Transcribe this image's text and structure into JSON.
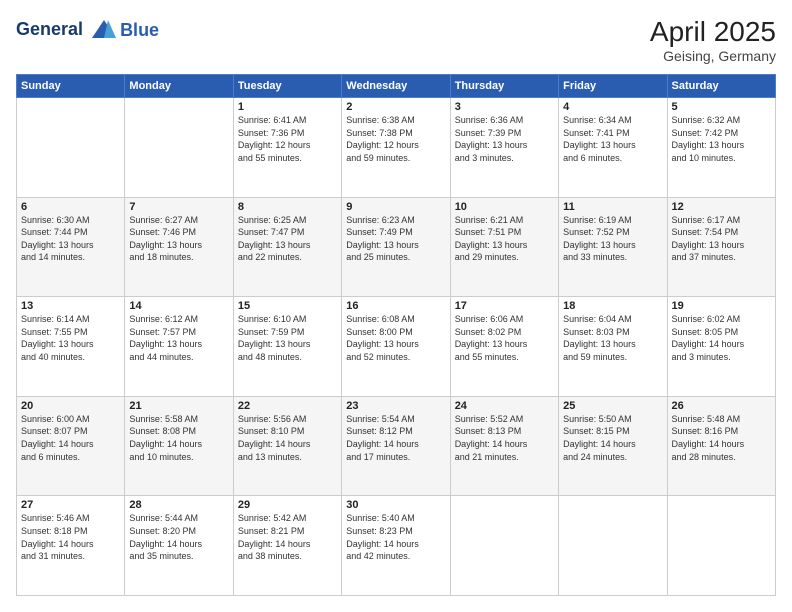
{
  "header": {
    "logo_line1": "General",
    "logo_line2": "Blue",
    "month_year": "April 2025",
    "location": "Geising, Germany"
  },
  "weekdays": [
    "Sunday",
    "Monday",
    "Tuesday",
    "Wednesday",
    "Thursday",
    "Friday",
    "Saturday"
  ],
  "weeks": [
    [
      {
        "day": "",
        "info": ""
      },
      {
        "day": "",
        "info": ""
      },
      {
        "day": "1",
        "info": "Sunrise: 6:41 AM\nSunset: 7:36 PM\nDaylight: 12 hours\nand 55 minutes."
      },
      {
        "day": "2",
        "info": "Sunrise: 6:38 AM\nSunset: 7:38 PM\nDaylight: 12 hours\nand 59 minutes."
      },
      {
        "day": "3",
        "info": "Sunrise: 6:36 AM\nSunset: 7:39 PM\nDaylight: 13 hours\nand 3 minutes."
      },
      {
        "day": "4",
        "info": "Sunrise: 6:34 AM\nSunset: 7:41 PM\nDaylight: 13 hours\nand 6 minutes."
      },
      {
        "day": "5",
        "info": "Sunrise: 6:32 AM\nSunset: 7:42 PM\nDaylight: 13 hours\nand 10 minutes."
      }
    ],
    [
      {
        "day": "6",
        "info": "Sunrise: 6:30 AM\nSunset: 7:44 PM\nDaylight: 13 hours\nand 14 minutes."
      },
      {
        "day": "7",
        "info": "Sunrise: 6:27 AM\nSunset: 7:46 PM\nDaylight: 13 hours\nand 18 minutes."
      },
      {
        "day": "8",
        "info": "Sunrise: 6:25 AM\nSunset: 7:47 PM\nDaylight: 13 hours\nand 22 minutes."
      },
      {
        "day": "9",
        "info": "Sunrise: 6:23 AM\nSunset: 7:49 PM\nDaylight: 13 hours\nand 25 minutes."
      },
      {
        "day": "10",
        "info": "Sunrise: 6:21 AM\nSunset: 7:51 PM\nDaylight: 13 hours\nand 29 minutes."
      },
      {
        "day": "11",
        "info": "Sunrise: 6:19 AM\nSunset: 7:52 PM\nDaylight: 13 hours\nand 33 minutes."
      },
      {
        "day": "12",
        "info": "Sunrise: 6:17 AM\nSunset: 7:54 PM\nDaylight: 13 hours\nand 37 minutes."
      }
    ],
    [
      {
        "day": "13",
        "info": "Sunrise: 6:14 AM\nSunset: 7:55 PM\nDaylight: 13 hours\nand 40 minutes."
      },
      {
        "day": "14",
        "info": "Sunrise: 6:12 AM\nSunset: 7:57 PM\nDaylight: 13 hours\nand 44 minutes."
      },
      {
        "day": "15",
        "info": "Sunrise: 6:10 AM\nSunset: 7:59 PM\nDaylight: 13 hours\nand 48 minutes."
      },
      {
        "day": "16",
        "info": "Sunrise: 6:08 AM\nSunset: 8:00 PM\nDaylight: 13 hours\nand 52 minutes."
      },
      {
        "day": "17",
        "info": "Sunrise: 6:06 AM\nSunset: 8:02 PM\nDaylight: 13 hours\nand 55 minutes."
      },
      {
        "day": "18",
        "info": "Sunrise: 6:04 AM\nSunset: 8:03 PM\nDaylight: 13 hours\nand 59 minutes."
      },
      {
        "day": "19",
        "info": "Sunrise: 6:02 AM\nSunset: 8:05 PM\nDaylight: 14 hours\nand 3 minutes."
      }
    ],
    [
      {
        "day": "20",
        "info": "Sunrise: 6:00 AM\nSunset: 8:07 PM\nDaylight: 14 hours\nand 6 minutes."
      },
      {
        "day": "21",
        "info": "Sunrise: 5:58 AM\nSunset: 8:08 PM\nDaylight: 14 hours\nand 10 minutes."
      },
      {
        "day": "22",
        "info": "Sunrise: 5:56 AM\nSunset: 8:10 PM\nDaylight: 14 hours\nand 13 minutes."
      },
      {
        "day": "23",
        "info": "Sunrise: 5:54 AM\nSunset: 8:12 PM\nDaylight: 14 hours\nand 17 minutes."
      },
      {
        "day": "24",
        "info": "Sunrise: 5:52 AM\nSunset: 8:13 PM\nDaylight: 14 hours\nand 21 minutes."
      },
      {
        "day": "25",
        "info": "Sunrise: 5:50 AM\nSunset: 8:15 PM\nDaylight: 14 hours\nand 24 minutes."
      },
      {
        "day": "26",
        "info": "Sunrise: 5:48 AM\nSunset: 8:16 PM\nDaylight: 14 hours\nand 28 minutes."
      }
    ],
    [
      {
        "day": "27",
        "info": "Sunrise: 5:46 AM\nSunset: 8:18 PM\nDaylight: 14 hours\nand 31 minutes."
      },
      {
        "day": "28",
        "info": "Sunrise: 5:44 AM\nSunset: 8:20 PM\nDaylight: 14 hours\nand 35 minutes."
      },
      {
        "day": "29",
        "info": "Sunrise: 5:42 AM\nSunset: 8:21 PM\nDaylight: 14 hours\nand 38 minutes."
      },
      {
        "day": "30",
        "info": "Sunrise: 5:40 AM\nSunset: 8:23 PM\nDaylight: 14 hours\nand 42 minutes."
      },
      {
        "day": "",
        "info": ""
      },
      {
        "day": "",
        "info": ""
      },
      {
        "day": "",
        "info": ""
      }
    ]
  ]
}
